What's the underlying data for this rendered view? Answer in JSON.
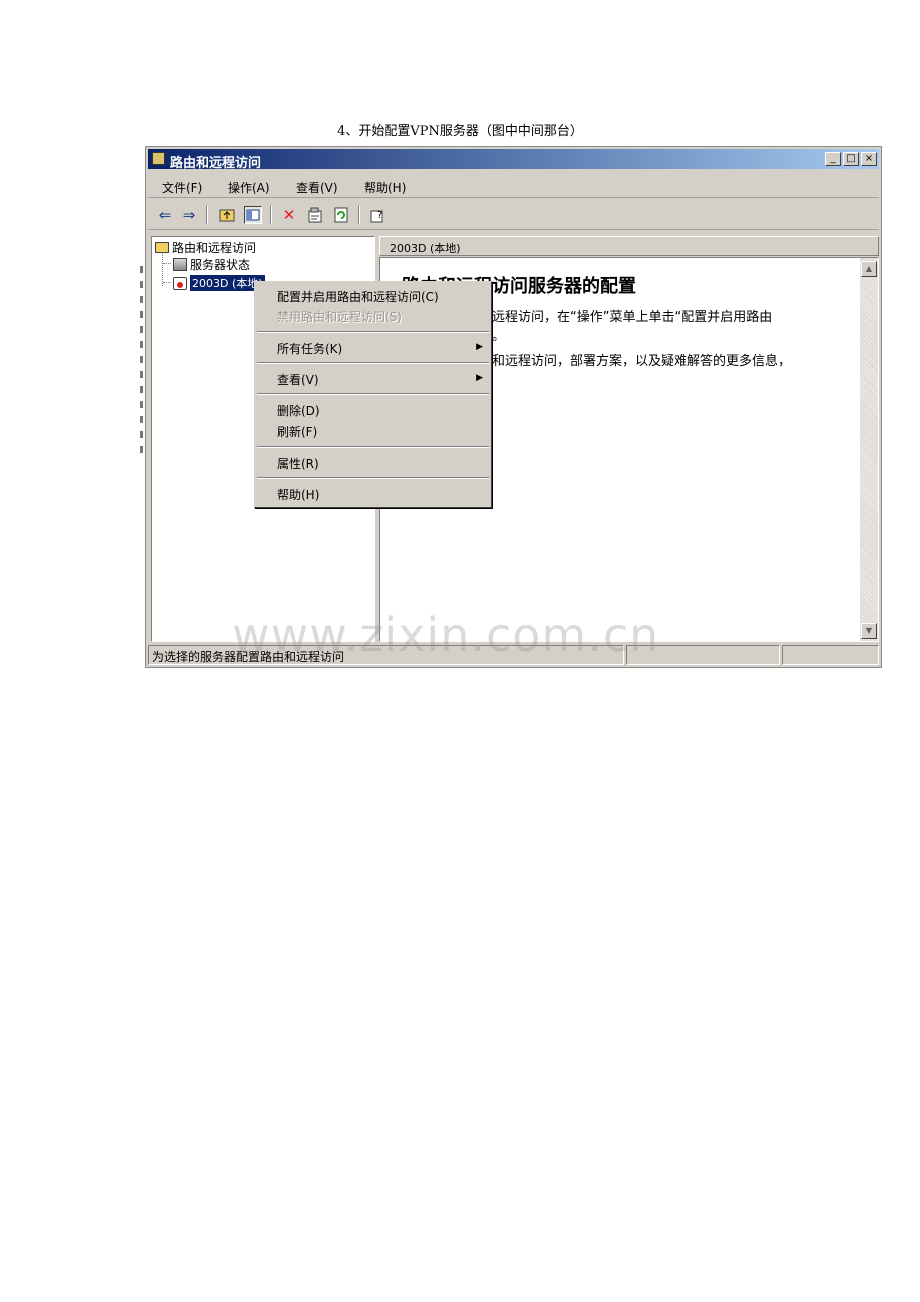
{
  "caption": "4、开始配置VPN服务器（图中中间那台）",
  "window": {
    "title": "路由和远程访问",
    "buttons": {
      "minimize": "_",
      "maximize": "□",
      "close": "×"
    }
  },
  "menubar": {
    "file": "文件(F)",
    "action": "操作(A)",
    "view": "查看(V)",
    "help": "帮助(H)"
  },
  "toolbar": {
    "icons": [
      "back-arrow-icon",
      "forward-arrow-icon",
      "up-folder-icon",
      "show-tree-icon",
      "delete-icon",
      "properties-icon",
      "refresh-icon",
      "help-icon"
    ]
  },
  "tree": {
    "root": "路由和远程访问",
    "server_status": "服务器状态",
    "server": "2003D (本地)"
  },
  "content": {
    "header": "2003D (本地)",
    "title": "路由和远程访问服务器的配置",
    "line1": "远程访问，在“操作”菜单上单击“配置并启用路由",
    "line2": "。",
    "line3": "和远程访问，部署方案，以及疑难解答的更多信息，"
  },
  "status": {
    "text": "为选择的服务器配置路由和远程访问"
  },
  "context_menu": {
    "configure": "配置并启用路由和远程访问(C)",
    "disable": "禁用路由和远程访问(S)",
    "all_tasks": "所有任务(K)",
    "view": "查看(V)",
    "delete": "删除(D)",
    "refresh": "刷新(F)",
    "properties": "属性(R)",
    "help": "帮助(H)"
  },
  "watermark": "www.zixin.com.cn",
  "colors": {
    "title_start": "#0a246a",
    "title_end": "#a6caf0",
    "face": "#d4d0c8",
    "delete_red": "#e02020"
  }
}
